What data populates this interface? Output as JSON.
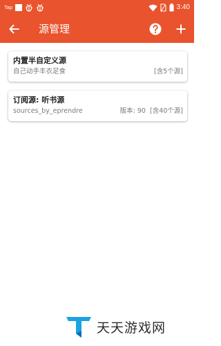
{
  "status_bar": {
    "tap_label": "Tap",
    "time": "3:40",
    "icons": [
      "square-icon",
      "bug-icon",
      "bug-icon",
      "wifi-icon",
      "sim-icon",
      "battery-icon"
    ]
  },
  "toolbar": {
    "title": "源管理",
    "back_icon": "arrow-left-icon",
    "help_icon": "help-circle-icon",
    "add_icon": "plus-icon"
  },
  "sources": [
    {
      "title": "内置半自定义源",
      "subtitle": "自己动手丰衣足食",
      "version": "",
      "count": "[含5个源]"
    },
    {
      "title": "订阅源: 听书源",
      "subtitle": "sources_by_eprendre",
      "version": "版本: 90",
      "count": "[含40个源]"
    }
  ],
  "watermark": {
    "text": "天天游戏网",
    "logo_icon": "tt-logo-icon"
  },
  "colors": {
    "primary": "#e9532d",
    "background": "#ffffff",
    "title_text": "#1f1f1f",
    "secondary_text": "#7a7a7a"
  }
}
